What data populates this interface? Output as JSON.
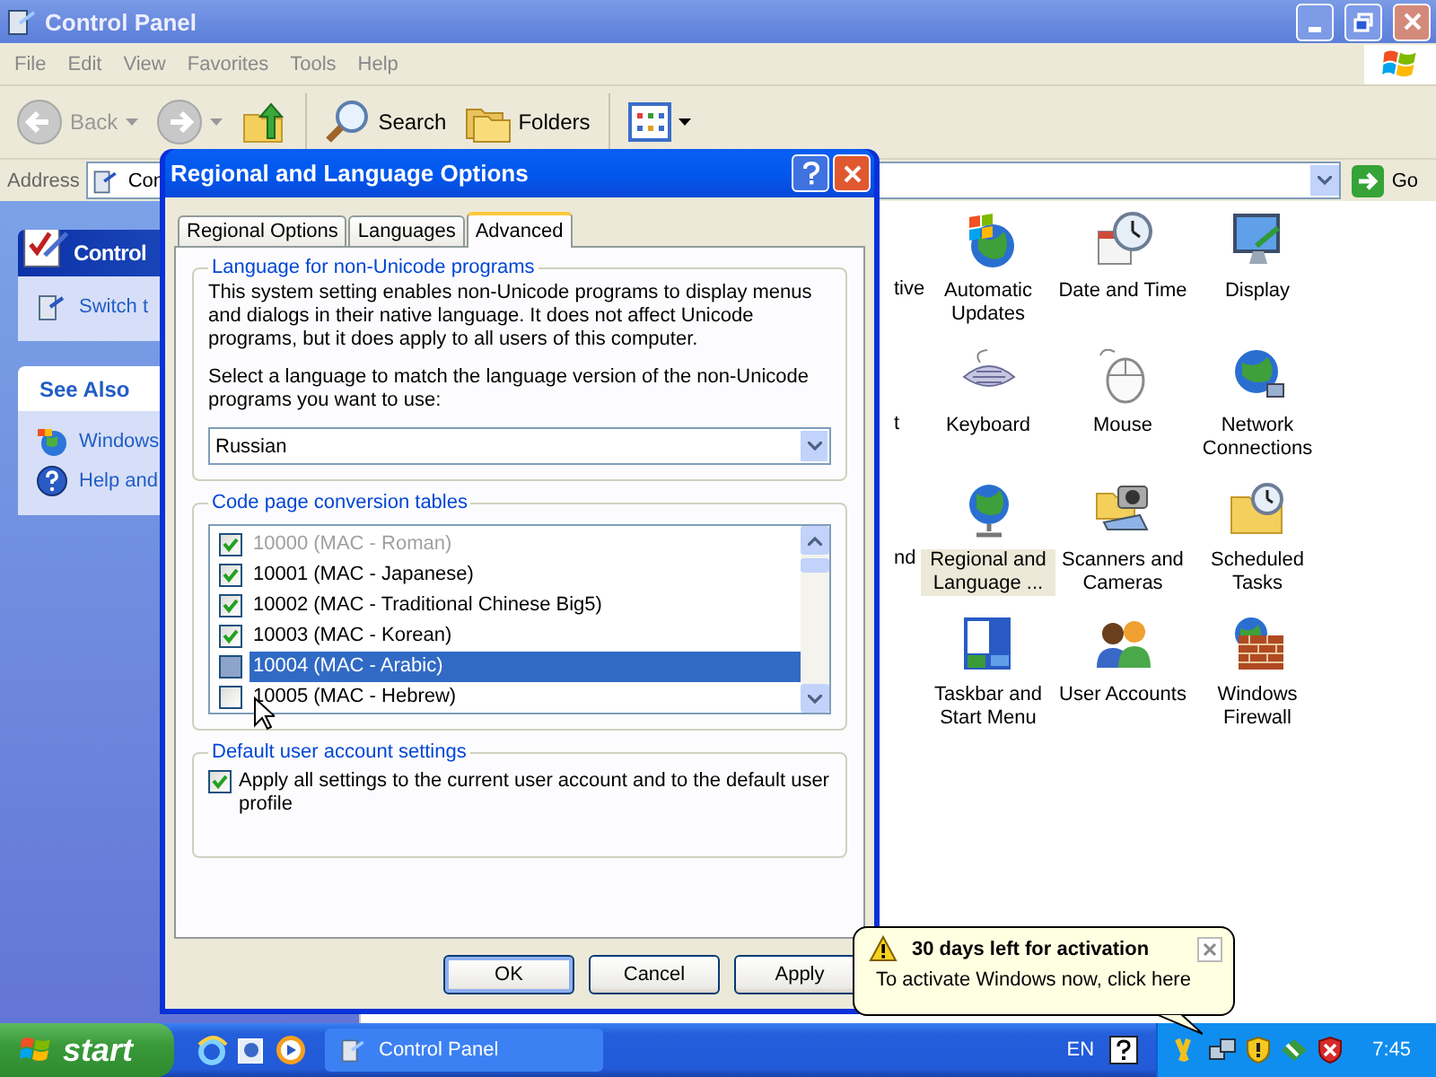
{
  "window": {
    "title": "Control Panel",
    "menu": [
      "File",
      "Edit",
      "View",
      "Favorites",
      "Tools",
      "Help"
    ],
    "toolbar": [
      [
        {
          "kind": "back",
          "label": "Back"
        },
        {
          "kind": "forward"
        },
        {
          "kind": "up"
        }
      ],
      [
        {
          "kind": "search",
          "label": "Search"
        },
        {
          "kind": "folders",
          "label": "Folders"
        }
      ],
      [
        {
          "kind": "views"
        }
      ]
    ],
    "address": {
      "label": "Address",
      "value": "Con",
      "go": "Go"
    }
  },
  "sidebar": [
    {
      "title": "Control",
      "kind": "header",
      "links": [
        {
          "kind": "switch",
          "label": "Switch t"
        }
      ]
    },
    {
      "title": "See Also",
      "kind": "plain",
      "links": [
        {
          "kind": "windows",
          "label": "Windows"
        },
        {
          "kind": "help",
          "label": "Help and"
        }
      ]
    }
  ],
  "icons": [
    {
      "partial": "tive",
      "items": [
        {
          "kind": "updates",
          "label": "Automatic Updates",
          "selected": false
        },
        {
          "kind": "clock",
          "label": "Date and Time",
          "selected": false
        },
        {
          "kind": "display",
          "label": "Display",
          "selected": false
        }
      ]
    },
    {
      "partial": "t",
      "items": [
        {
          "kind": "keyboard",
          "label": "Keyboard",
          "selected": false
        },
        {
          "kind": "mouse",
          "label": "Mouse",
          "selected": false
        },
        {
          "kind": "network",
          "label": "Network Connections",
          "selected": false
        }
      ]
    },
    {
      "partial": "nd",
      "items": [
        {
          "kind": "regional",
          "label": "Regional and Language ...",
          "selected": true
        },
        {
          "kind": "scanners",
          "label": "Scanners and Cameras",
          "selected": false
        },
        {
          "kind": "scheduled",
          "label": "Scheduled Tasks",
          "selected": false
        }
      ]
    },
    {
      "items": [
        {
          "kind": "taskbar",
          "label": "Taskbar and Start Menu",
          "selected": false
        },
        {
          "kind": "users",
          "label": "User Accounts",
          "selected": false
        },
        {
          "kind": "firewall",
          "label": "Windows Firewall",
          "selected": false
        }
      ]
    }
  ],
  "dialog": {
    "title": "Regional and Language Options",
    "tabs": [
      {
        "label": "Regional Options",
        "selected": false
      },
      {
        "label": "Languages",
        "selected": false
      },
      {
        "label": "Advanced",
        "selected": true
      }
    ],
    "language_group": {
      "title": "Language for non-Unicode programs",
      "description": "This system setting enables non-Unicode programs to display menus and dialogs in their native language. It does not affect Unicode programs, but it does apply to all users of this computer.",
      "prompt": "Select a language to match the language version of the non-Unicode programs you want to use:",
      "select": "Russian"
    },
    "codepage_group": {
      "title": "Code page conversion tables",
      "items": [
        {
          "label": "10000 (MAC - Roman)",
          "checked": true,
          "disabled": true,
          "selected": false
        },
        {
          "label": "10001 (MAC - Japanese)",
          "checked": true,
          "disabled": false,
          "selected": false
        },
        {
          "label": "10002 (MAC - Traditional Chinese Big5)",
          "checked": true,
          "disabled": false,
          "selected": false
        },
        {
          "label": "10003 (MAC - Korean)",
          "checked": true,
          "disabled": false,
          "selected": false
        },
        {
          "label": "10004 (MAC - Arabic)",
          "checked": false,
          "disabled": false,
          "selected": true
        },
        {
          "label": "10005 (MAC - Hebrew)",
          "checked": false,
          "disabled": false,
          "selected": false
        }
      ]
    },
    "default_group": {
      "title": "Default user account settings",
      "checkbox": {
        "label": "Apply all settings to the current user account and to the default user profile",
        "checked": true
      }
    },
    "buttons": [
      {
        "label": "OK",
        "default": true
      },
      {
        "label": "Cancel",
        "default": false
      },
      {
        "label": "Apply",
        "default": false
      }
    ]
  },
  "balloon": {
    "title": "30 days left for activation",
    "text": "To activate Windows now, click here"
  },
  "taskbar": {
    "start": "start",
    "tasks": [
      {
        "label": "Control Panel"
      }
    ],
    "language": "EN",
    "clock": "7:45"
  }
}
